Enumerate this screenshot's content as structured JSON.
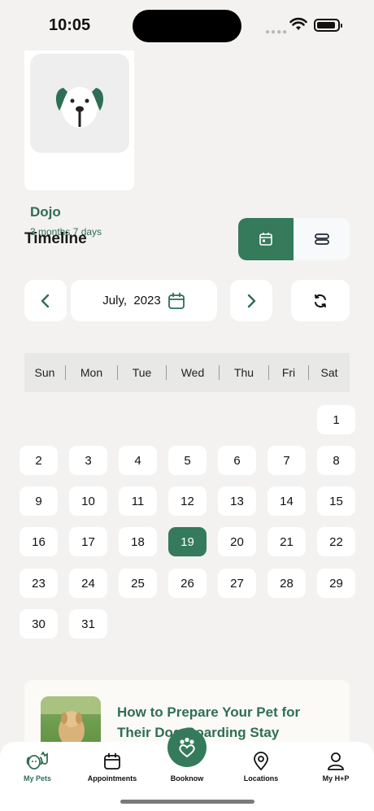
{
  "status_bar": {
    "time": "10:05"
  },
  "pet": {
    "name": "Dojo",
    "age": "3 months 7 days"
  },
  "timeline": {
    "title": "Timeline",
    "view_modes": [
      "calendar-icon",
      "list-icon"
    ],
    "active_view": "calendar"
  },
  "calendar": {
    "month_label": "July,  2023",
    "weekdays": [
      "Sun",
      "Mon",
      "Tue",
      "Wed",
      "Thu",
      "Fri",
      "Sat"
    ],
    "days": [
      "1",
      "2",
      "3",
      "4",
      "5",
      "6",
      "7",
      "8",
      "9",
      "10",
      "11",
      "12",
      "13",
      "14",
      "15",
      "16",
      "17",
      "18",
      "19",
      "20",
      "21",
      "22",
      "23",
      "24",
      "25",
      "26",
      "27",
      "28",
      "29",
      "30",
      "31"
    ],
    "selected_day": "19"
  },
  "article": {
    "title": "How to Prepare Your Pet for Their Dog Boarding Stay"
  },
  "tabbar": {
    "tabs": [
      {
        "label": "My Pets",
        "icon": "pets-icon",
        "active": true
      },
      {
        "label": "Appointments",
        "icon": "calendar-icon",
        "active": false
      },
      {
        "label": "Booknow",
        "icon": "paw-heart-icon",
        "active": false
      },
      {
        "label": "Locations",
        "icon": "location-pin-icon",
        "active": false
      },
      {
        "label": "My H+P",
        "icon": "person-icon",
        "active": false
      }
    ]
  },
  "colors": {
    "accent": "#347a5b",
    "accent_text": "#2f6e55",
    "background": "#f3f2f0"
  }
}
